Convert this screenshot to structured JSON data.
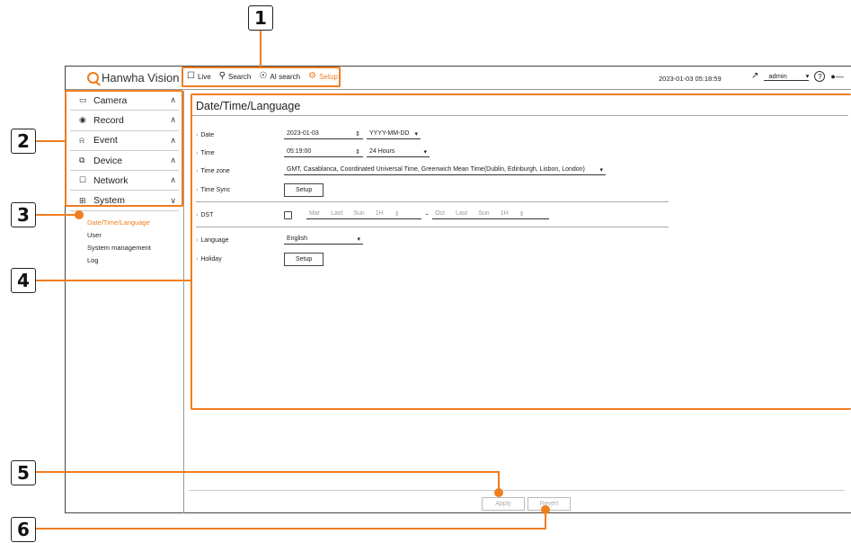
{
  "callouts": [
    "1",
    "2",
    "3",
    "4",
    "5",
    "6"
  ],
  "brand": "Hanwha Vision",
  "topnav": [
    {
      "label": "Live",
      "icon": "monitor-icon"
    },
    {
      "label": "Search",
      "icon": "search-icon"
    },
    {
      "label": "AI search",
      "icon": "ai-search-icon"
    },
    {
      "label": "Setup",
      "icon": "gear-icon"
    }
  ],
  "datetime": "2023-01-03 05:18:59",
  "user": "admin",
  "help": "?",
  "sidebar": [
    {
      "label": "Camera",
      "icon": "camera-icon",
      "chev": "^"
    },
    {
      "label": "Record",
      "icon": "record-icon",
      "chev": "^"
    },
    {
      "label": "Event",
      "icon": "bell-icon",
      "chev": "^"
    },
    {
      "label": "Device",
      "icon": "device-icon",
      "chev": "^"
    },
    {
      "label": "Network",
      "icon": "network-icon",
      "chev": "^"
    },
    {
      "label": "System",
      "icon": "system-icon",
      "chev": "v"
    }
  ],
  "submenu": [
    "Date/Time/Language",
    "User",
    "System management",
    "Log"
  ],
  "page": {
    "title": "Date/Time/Language",
    "date_label": "Date",
    "date_value": "2023-01-03",
    "date_format": "YYYY-MM-DD",
    "time_label": "Time",
    "time_value": "05:19:00",
    "time_format": "24 Hours",
    "timezone_label": "Time zone",
    "timezone_value": "GMT, Casablanca, Coordinated Universal Time, Greenwich Mean Time(Dublin, Edinburgh, Lisbon, London)",
    "timesync_label": "Time Sync",
    "setup_button": "Setup",
    "dst_label": "DST",
    "dst_start_month": "Mar",
    "dst_start_week": "Last",
    "dst_start_day": "Sun",
    "dst_start_hour": "1H",
    "dst_sep": "~",
    "dst_end_month": "Oct",
    "dst_end_week": "Last",
    "dst_end_day": "Sun",
    "dst_end_hour": "1H",
    "language_label": "Language",
    "language_value": "English",
    "holiday_label": "Holiday",
    "holiday_button": "Setup",
    "apply_button": "Apply",
    "revert_button": "Revert"
  },
  "colors": {
    "accent": "#f07d1e"
  }
}
